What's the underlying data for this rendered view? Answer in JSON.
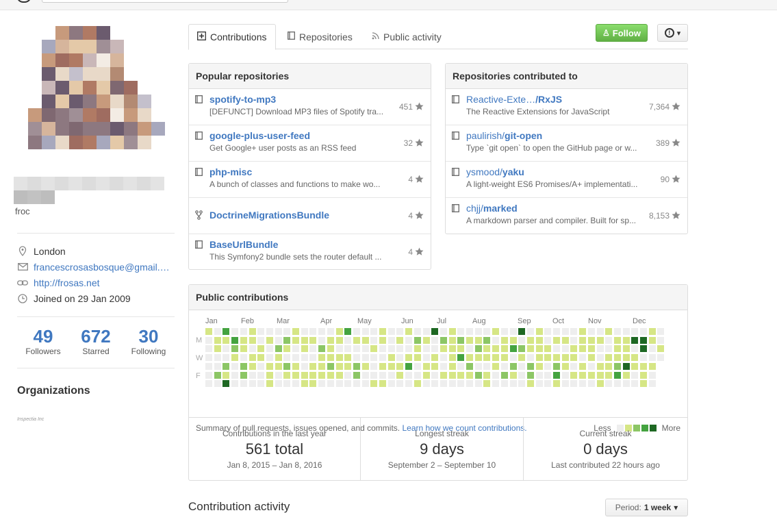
{
  "header": {},
  "profile": {
    "name_fragment": "froc",
    "location": "London",
    "email": "francescrosasbosque@gmail.com",
    "website": "http://frosas.net",
    "joined": "Joined on 29 Jan 2009",
    "stats": [
      {
        "value": "49",
        "label": "Followers"
      },
      {
        "value": "672",
        "label": "Starred"
      },
      {
        "value": "30",
        "label": "Following"
      }
    ],
    "organizations_title": "Organizations",
    "org_logo_text": "Inspectia Inc"
  },
  "tabs": [
    {
      "label": "Contributions",
      "icon": "contributions-icon"
    },
    {
      "label": "Repositories",
      "icon": "repo-icon"
    },
    {
      "label": "Public activity",
      "icon": "rss-icon"
    }
  ],
  "actions": {
    "follow_label": "Follow",
    "alert_label": "!"
  },
  "popular_repos": {
    "title": "Popular repositories",
    "items": [
      {
        "name": "spotify-to-mp3",
        "desc": "[DEFUNCT] Download MP3 files of Spotify tra...",
        "stars": "451",
        "icon": "repo-icon"
      },
      {
        "name": "google-plus-user-feed",
        "desc": "Get Google+ user posts as an RSS feed",
        "stars": "32",
        "icon": "repo-icon"
      },
      {
        "name": "php-misc",
        "desc": "A bunch of classes and functions to make wo...",
        "stars": "4",
        "icon": "repo-icon"
      },
      {
        "name": "DoctrineMigrationsBundle",
        "desc": "",
        "stars": "4",
        "icon": "fork-icon"
      },
      {
        "name": "BaseUrlBundle",
        "desc": "This Symfony2 bundle sets the router default ...",
        "stars": "4",
        "icon": "repo-icon"
      }
    ]
  },
  "contributed_repos": {
    "title": "Repositories contributed to",
    "items": [
      {
        "owner": "Reactive-Exte…",
        "name": "/RxJS",
        "desc": "The Reactive Extensions for JavaScript",
        "stars": "7,364"
      },
      {
        "owner": "paulirish/",
        "name": "git-open",
        "desc": "Type `git open` to open the GitHub page or w...",
        "stars": "389"
      },
      {
        "owner": "ysmood/",
        "name": "yaku",
        "desc": "A light-weight ES6 Promises/A+ implementati...",
        "stars": "90"
      },
      {
        "owner": "chjj/",
        "name": "marked",
        "desc": "A markdown parser and compiler. Built for sp...",
        "stars": "8,153"
      }
    ]
  },
  "contributions": {
    "title": "Public contributions",
    "months": [
      "Jan",
      "Feb",
      "Mar",
      "Apr",
      "May",
      "Jun",
      "Jul",
      "Aug",
      "Sep",
      "Oct",
      "Nov",
      "Dec"
    ],
    "days": [
      "M",
      "W",
      "F"
    ],
    "summary": "Summary of pull requests, issues opened, and commits.",
    "learn_link": "Learn how we count contributions.",
    "legend_less": "Less",
    "legend_more": "More",
    "colors": [
      "#eeeeee",
      "#d6e685",
      "#8cc665",
      "#44a340",
      "#1e6823"
    ],
    "stats": [
      {
        "title": "Contributions in the last year",
        "value": "561 total",
        "sub": "Jan 8, 2015 – Jan 8, 2016"
      },
      {
        "title": "Longest streak",
        "value": "9 days",
        "sub": "September 2 – September 10"
      },
      {
        "title": "Current streak",
        "value": "0 days",
        "sub": "Last contributed 22 hours ago"
      }
    ]
  },
  "activity": {
    "title": "Contribution activity",
    "period_label": "Period:",
    "period_value": "1 week"
  }
}
